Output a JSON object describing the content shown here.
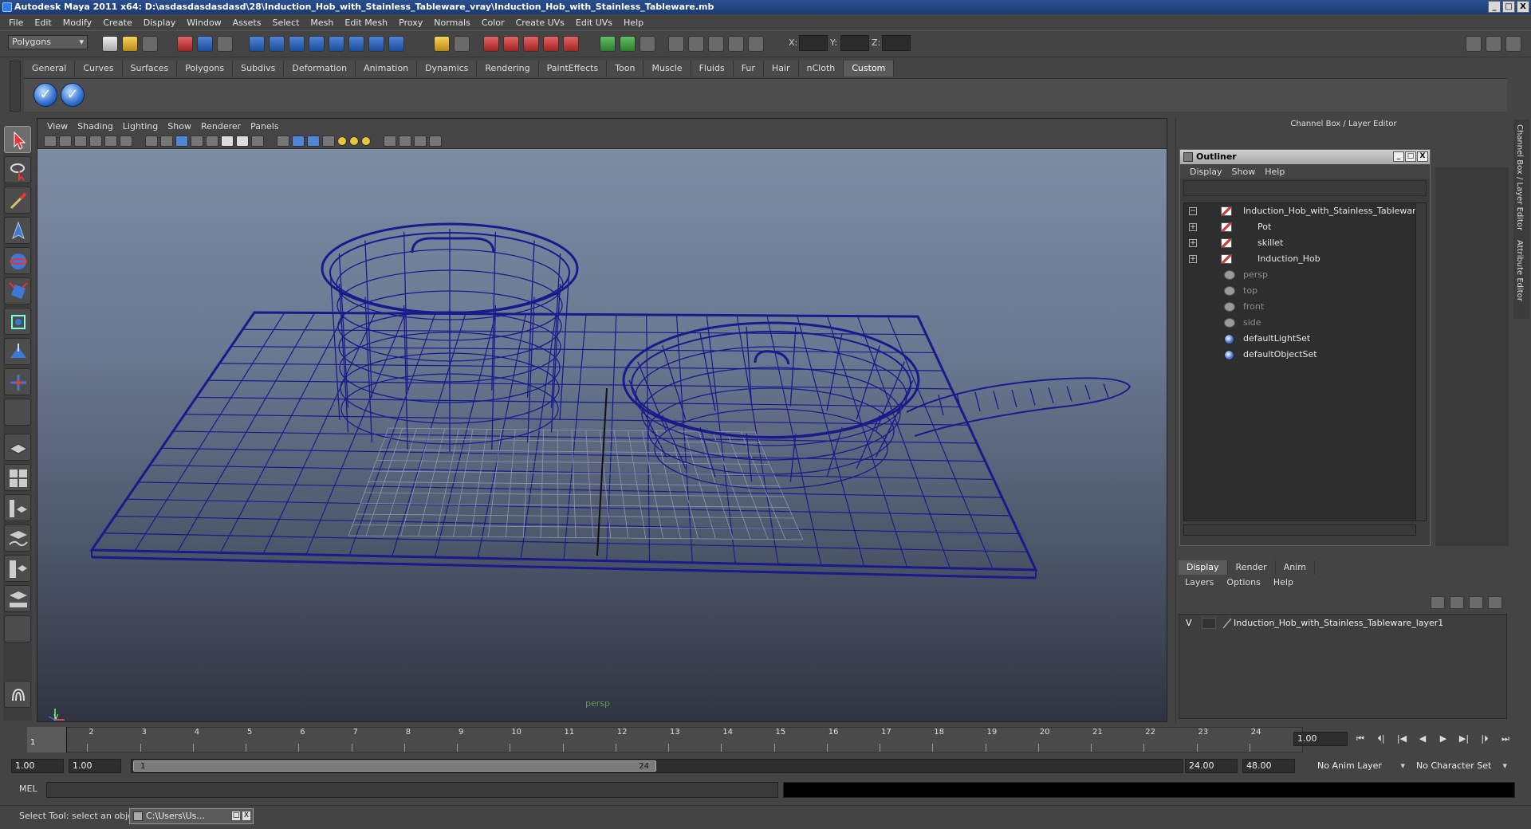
{
  "window": {
    "title": "Autodesk Maya 2011 x64: D:\\asdasdasdasdasd\\28\\Induction_Hob_with_Stainless_Tableware_vray\\Induction_Hob_with_Stainless_Tableware.mb",
    "minimize": "_",
    "maximize": "□",
    "close": "X"
  },
  "menubar": [
    "File",
    "Edit",
    "Modify",
    "Create",
    "Display",
    "Window",
    "Assets",
    "Select",
    "Mesh",
    "Edit Mesh",
    "Proxy",
    "Normals",
    "Color",
    "Create UVs",
    "Edit UVs",
    "Help"
  ],
  "statusline": {
    "mode": "Polygons",
    "x_label": "X:",
    "y_label": "Y:",
    "z_label": "Z:"
  },
  "shelf": {
    "tabs": [
      "General",
      "Curves",
      "Surfaces",
      "Polygons",
      "Subdivs",
      "Deformation",
      "Animation",
      "Dynamics",
      "Rendering",
      "PaintEffects",
      "Toon",
      "Muscle",
      "Fluids",
      "Fur",
      "Hair",
      "nCloth",
      "Custom"
    ],
    "active_tab": "Custom",
    "button_glyph": "✓"
  },
  "viewport": {
    "menu": [
      "View",
      "Shading",
      "Lighting",
      "Show",
      "Renderer",
      "Panels"
    ],
    "camera": "persp",
    "axis_y": "y",
    "wire_color": "#1a1a8c"
  },
  "channel_box": {
    "title": "Channel Box / Layer Editor",
    "side_tabs": [
      "Channel Box / Layer Editor",
      "Attribute Editor"
    ]
  },
  "outliner": {
    "title": "Outliner",
    "menu": [
      "Display",
      "Show",
      "Help"
    ],
    "items": [
      {
        "label": "Induction_Hob_with_Stainless_Tableware",
        "expander": "−",
        "type": "object",
        "level": 0
      },
      {
        "label": "Pot",
        "expander": "+",
        "type": "object",
        "level": 1
      },
      {
        "label": "skillet",
        "expander": "+",
        "type": "object",
        "level": 1
      },
      {
        "label": "Induction_Hob",
        "expander": "+",
        "type": "object",
        "level": 1
      },
      {
        "label": "persp",
        "expander": "",
        "type": "camera",
        "level": 0
      },
      {
        "label": "top",
        "expander": "",
        "type": "camera",
        "level": 0
      },
      {
        "label": "front",
        "expander": "",
        "type": "camera",
        "level": 0
      },
      {
        "label": "side",
        "expander": "",
        "type": "camera",
        "level": 0
      },
      {
        "label": "defaultLightSet",
        "expander": "",
        "type": "set",
        "level": 0
      },
      {
        "label": "defaultObjectSet",
        "expander": "",
        "type": "set",
        "level": 0
      }
    ]
  },
  "layer_editor": {
    "tabs": [
      "Display",
      "Render",
      "Anim"
    ],
    "active_tab": "Display",
    "menu": [
      "Layers",
      "Options",
      "Help"
    ],
    "layer": {
      "visible": "V",
      "name": "Induction_Hob_with_Stainless_Tableware_layer1"
    }
  },
  "timeline": {
    "ticks": [
      "1",
      "2",
      "3",
      "4",
      "5",
      "6",
      "7",
      "8",
      "9",
      "10",
      "11",
      "12",
      "13",
      "14",
      "15",
      "16",
      "17",
      "18",
      "19",
      "20",
      "21",
      "22",
      "23",
      "24"
    ],
    "current_marker": "1",
    "current_frame": "1.00",
    "playback": [
      "⏮",
      "⏴|",
      "|◀",
      "◀",
      "▶",
      "▶|",
      "|⏵",
      "⏭"
    ]
  },
  "range": {
    "start": "1.00",
    "playback_start": "1.00",
    "thumb_start": "1",
    "thumb_end": "24",
    "playback_end": "24.00",
    "end": "48.00",
    "anim_layer": "No Anim Layer",
    "character_set": "No Character Set"
  },
  "command_line": {
    "label": "MEL"
  },
  "help_line": {
    "text": "Select Tool: select an object",
    "task_item": "C:\\Users\\Us..."
  }
}
